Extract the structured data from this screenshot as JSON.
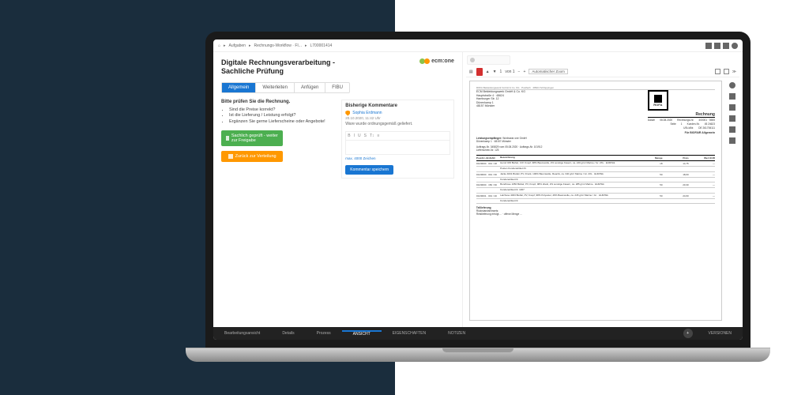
{
  "breadcrumbs": {
    "home": "⌂",
    "sep": "▸",
    "item1": "Aufgaben",
    "item2": "Rechnungs-Workflow · FI...",
    "item3": "L700001414"
  },
  "topIcons": [
    "grid",
    "menu",
    "expand",
    "user"
  ],
  "header": {
    "title": "Digitale Rechnungsverarbeitung - Sachliche Prüfung",
    "logoText": "ecm:one"
  },
  "tabs": [
    {
      "label": "Allgemein",
      "active": true
    },
    {
      "label": "Weiterleiten",
      "active": false
    },
    {
      "label": "Anfügen",
      "active": false
    },
    {
      "label": "FIBU",
      "active": false
    }
  ],
  "checklist": {
    "title": "Bitte prüfen Sie die Rechnung.",
    "items": [
      "Sind die Preise korrekt?",
      "Ist die Lieferung / Leistung erfolgt?",
      "Ergänzen Sie gerne Lieferscheine oder Angebote!"
    ]
  },
  "buttons": {
    "approve": "Sachlich geprüft - weiter zur Freigabe",
    "back": "Zurück zur Verteilung",
    "saveComment": "Kommentar speichern"
  },
  "comments": {
    "title": "Bisherige Kommentare",
    "author": "Sophia Erdmann",
    "date": "20.10.2020, 11:42 Uhr",
    "body": "Ware wurde ordnungsgemäß geliefert.",
    "editor": [
      "B",
      "I",
      "U",
      "S",
      "T↕",
      "≡"
    ],
    "charCount": "max. 4000 Zeichen"
  },
  "docHeader": {
    "id": "L700001414"
  },
  "docToolbar": {
    "page": "1",
    "of": "von 1",
    "zoomLabel": "Automatischer Zoom"
  },
  "invoice": {
    "senderLine": "ROFA Bekleidungswerk GmbH & Co. KG · Postfach · 48624 Schöppingen",
    "recipient": {
      "l1": "ECM Bekleidungswerk GmbH & Co. KG",
      "l2": "Hauptstraße 4 · 48624",
      "l3": "Hamburger Str. 12",
      "l4": "Dünenkamp 1",
      "l5": "48157 Münster"
    },
    "logoText": "ROFA",
    "docType": "Rechnung",
    "meta": {
      "dateLbl": "Datum",
      "date": "06.08.2020",
      "pageLbl": "Seite",
      "page": "1",
      "noLbl": "Rechnungs-Nr.",
      "no": "400001 · 5555",
      "custLbl": "Kunden-Nr.",
      "cust": "45 24623",
      "ustLbl": "USt-IdNr.",
      "ust": "DE 261706111"
    },
    "ref": "Für BIOFAIR Allgemein",
    "delivery": {
      "lbl": "Leistungsempfänger:",
      "l1": "Workwear one GmbH",
      "l2": "Dünenkamp 1 · 48157 Münster"
    },
    "order": {
      "no": "Auftrags-Nr. 345829 vom 05.08.2020 · Auftrags-Nr. 101912",
      "ls": "Lieferschein-Nr. 125"
    },
    "cols": {
      "pos": "Pos/Art.-Nr./EAN",
      "desc": "Bezeichnung",
      "qty": "Menge",
      "price": "Preis",
      "total": "Wert EUR"
    },
    "rows": [
      {
        "pos": "01/29000 · 001 / 48",
        "desc": "Hemd 409\nBiofair, CO¹ Knopf, 98% Baumwolle, 2% sonstige Fasern, ca. 240 g/m²\nMarine / Gr. 2XL · EUR/Stk",
        "qty": "18",
        "price": "14,75",
        "total": "—"
      },
      {
        "pos": "",
        "desc": "Posten\nKundenartikel-Nr.",
        "qty": "",
        "price": "",
        "total": ""
      },
      {
        "pos": "01/29000 · 001 / 60",
        "desc": "Jacke 4001\nBiofair, PV, Druck, 100% Baumwolle, Reactiv, ca. 340 g/m²\nMarine / Gr. 2XL · EUR/Stk",
        "qty": "50",
        "price": "18,00",
        "total": "—"
      },
      {
        "pos": "",
        "desc": "Kundenartikel-Nr.",
        "qty": "",
        "price": "",
        "total": ""
      },
      {
        "pos": "01/29000 · 150 / 60",
        "desc": "Bundhose 1050\nBiofair, PV, Knopf, 98% direkt, 2% sonstige Fasern, ca. 285 g/m²\nMarine · EUR/Stk",
        "qty": "50",
        "price": "20,30",
        "total": "—"
      },
      {
        "pos": "",
        "desc": "Kundenartikel-Nr. 1007",
        "qty": "",
        "price": "",
        "total": ""
      },
      {
        "pos": "01/29001 · 001 / 40",
        "desc": "Latzhose 4003\nBiofair, PV, Knopf, 98% Polyester, 49% Baumwolle, ca. 245 g/m²\nMarine / Gr. · EUR/Stk",
        "qty": "50",
        "price": "24,60",
        "total": "—"
      },
      {
        "pos": "",
        "desc": "Kundenartikel-Nr.",
        "qty": "",
        "price": "",
        "total": ""
      }
    ],
    "footer": {
      "lbl": "Teillieferung",
      "note": "Rückstandshinweis:",
      "rest": "Restlieferung erfolgt ... · offene Menge ..."
    }
  },
  "sideIcons": [
    "info",
    "tag",
    "share",
    "download",
    "note",
    "trash"
  ],
  "footerTabs": [
    {
      "label": "Bearbeitungsansicht",
      "active": false
    },
    {
      "label": "Details",
      "active": false
    },
    {
      "label": "Prozess",
      "active": false
    },
    {
      "label": "ANSICHT",
      "active": true
    },
    {
      "label": "EIGENSCHAFTEN",
      "active": false
    },
    {
      "label": "NOTIZEN",
      "active": false
    },
    {
      "label": "VERSIONEN",
      "active": false
    }
  ]
}
